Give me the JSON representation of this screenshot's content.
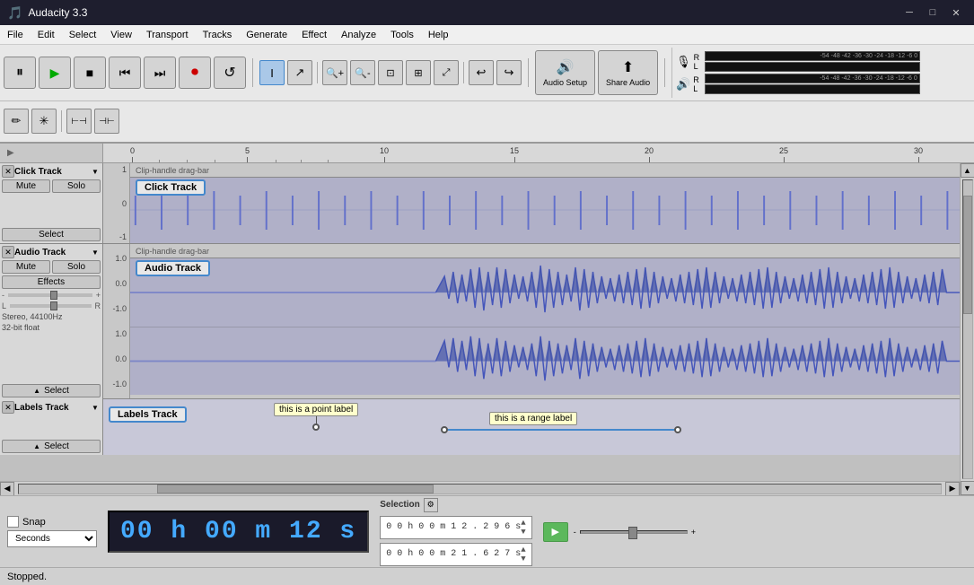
{
  "titlebar": {
    "title": "Audacity 3.3",
    "icon": "🎵",
    "minimize": "─",
    "maximize": "□",
    "close": "✕"
  },
  "menubar": {
    "items": [
      "File",
      "Edit",
      "Select",
      "View",
      "Transport",
      "Tracks",
      "Generate",
      "Effect",
      "Analyze",
      "Tools",
      "Help"
    ]
  },
  "toolbar": {
    "pause": "⏸",
    "play": "▶",
    "stop": "■",
    "skip_back": "⏮",
    "skip_forward": "⏭",
    "record": "⏺",
    "loop": "↺",
    "audio_setup_label": "Audio Setup",
    "share_audio_label": "Share Audio",
    "tools": [
      "I",
      "↗",
      "↔",
      "⟺",
      "Q",
      "Q+",
      "Q-",
      "Q~",
      "↩",
      "↪",
      "✏",
      "*",
      "≡",
      "⊕"
    ]
  },
  "meter": {
    "db_labels": [
      "-54",
      "-48",
      "-42",
      "-36",
      "-30",
      "-24",
      "-18",
      "-12",
      "-6",
      "0"
    ],
    "record_label": "R",
    "play_label": "L"
  },
  "ruler": {
    "ticks": [
      {
        "pos": 0,
        "label": "0"
      },
      {
        "pos": 120,
        "label": "5"
      },
      {
        "pos": 240,
        "label": "10"
      },
      {
        "pos": 360,
        "label": "15"
      },
      {
        "pos": 480,
        "label": "20"
      },
      {
        "pos": 600,
        "label": "25"
      },
      {
        "pos": 720,
        "label": "30"
      }
    ]
  },
  "tracks": {
    "click_track": {
      "name": "Click Track",
      "close_btn": "✕",
      "dropdown": "▼",
      "mute": "Mute",
      "solo": "Solo",
      "select": "Select",
      "clip_handle": "Clip-handle drag-bar",
      "scale": [
        "1",
        "0",
        "-1"
      ]
    },
    "audio_track": {
      "name": "Audio Track",
      "close_btn": "✕",
      "dropdown": "▼",
      "mute": "Mute",
      "solo": "Solo",
      "effects": "Effects",
      "select": "Select",
      "gain_minus": "-",
      "gain_plus": "+",
      "pan_l": "L",
      "pan_r": "R",
      "info": "Stereo, 44100Hz\n32-bit float",
      "clip_handle": "Clip-handle drag-bar",
      "scale_upper": [
        "1.0",
        "0.0",
        "-1.0"
      ],
      "scale_lower": [
        "1.0",
        "0.0",
        "-1.0"
      ]
    },
    "labels_track": {
      "name": "Labels Track",
      "close_btn": "✕",
      "dropdown": "▼",
      "select": "Select",
      "point_label": "this is a point label",
      "range_label": "this is a range label"
    }
  },
  "bottom": {
    "snap_label": "Snap",
    "time": "00 h 00 m 12 s",
    "seconds_label": "Seconds",
    "selection_label": "Selection",
    "sel_start": "0 0 h 0 0 m 1 2 . 2 9 6 s",
    "sel_end": "0 0 h 0 0 m 2 1 . 6 2 7 s",
    "play_icon": "▶"
  },
  "statusbar": {
    "text": "Stopped."
  }
}
